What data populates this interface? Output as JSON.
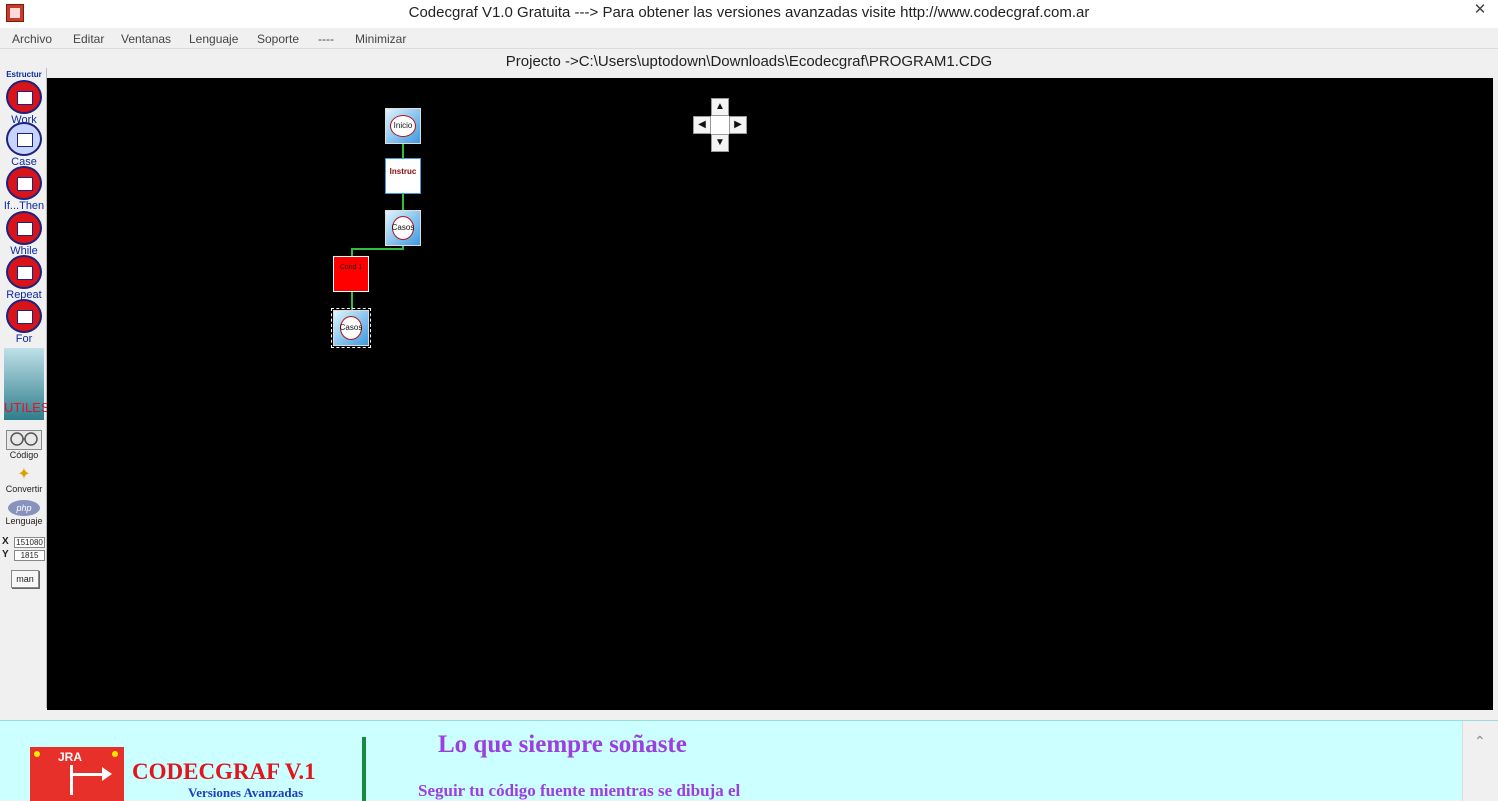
{
  "window": {
    "title": "Codecgraf V1.0 Gratuita ---> Para obtener las versiones avanzadas visite http://www.codecgraf.com.ar",
    "close_glyph": "✕"
  },
  "menu": {
    "items": [
      "Archivo",
      "Editar",
      "Ventanas",
      "Lenguaje",
      "Soporte",
      "----",
      "Minimizar"
    ]
  },
  "project": {
    "path_text": "Projecto ->C:\\Users\\uptodown\\Downloads\\Ecodecgraf\\PROGRAM1.CDG"
  },
  "sidebar": {
    "header": "Estructur",
    "tools": [
      {
        "label": "Work",
        "icon": "work-structure-icon"
      },
      {
        "label": "Case",
        "icon": "case-structure-icon"
      },
      {
        "label": "If...Then",
        "icon": "if-then-structure-icon"
      },
      {
        "label": "While",
        "icon": "while-structure-icon"
      },
      {
        "label": "Repeat",
        "icon": "repeat-structure-icon"
      },
      {
        "label": "For",
        "icon": "for-structure-icon"
      }
    ],
    "utiles_label": "UTILES",
    "codigo_label": "Código",
    "convertir_label": "Convertir",
    "lenguaje_label": "Lenguaje",
    "php_badge": "php",
    "coord_x_axis": "X",
    "coord_y_axis": "Y",
    "coord_x_value": "151080",
    "coord_y_value": "1815",
    "man_button": "man"
  },
  "canvas": {
    "background": "#000000",
    "connector_color": "#2fbf3b",
    "nodes": {
      "inicio": "Inicio",
      "instruc": "Instruc",
      "casos_1": "Casos",
      "cond_1": "Cond 1",
      "casos_2": "Casos"
    },
    "nav": {
      "up": "▲",
      "down": "▼",
      "left": "◀",
      "right": "▶"
    }
  },
  "banner": {
    "logo_text": "JRA",
    "brand": "CODECGRAF V.1",
    "brand_sub": "Versiones Avanzadas",
    "slogan": "Lo que siempre soñaste",
    "slogan_sub": "Seguir tu código fuente mientras se dibuja el",
    "scroll_up_glyph": "⌃"
  }
}
